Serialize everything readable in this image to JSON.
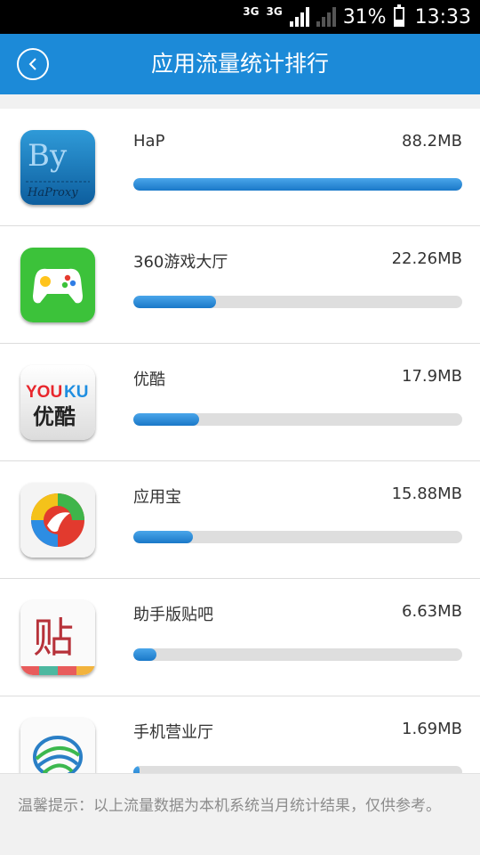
{
  "status_bar": {
    "network_1": "3G",
    "network_2": "3G",
    "battery_percent": "31%",
    "battery_level": 0.31,
    "time": "13:33"
  },
  "header": {
    "title": "应用流量统计排行",
    "back_icon": "back-arrow-icon"
  },
  "apps": [
    {
      "name": "HaP",
      "size": "88.2MB",
      "usage_fraction": 1.0,
      "icon": "haproxy-app-icon",
      "icon_text": "By HaProxy"
    },
    {
      "name": "360游戏大厅",
      "size": "22.26MB",
      "usage_fraction": 0.25,
      "icon": "360-game-hall-app-icon"
    },
    {
      "name": "优酷",
      "size": "17.9MB",
      "usage_fraction": 0.2,
      "icon": "youku-app-icon",
      "icon_text": "YOUKU 优酷"
    },
    {
      "name": "应用宝",
      "size": "15.88MB",
      "usage_fraction": 0.18,
      "icon": "yingyongbao-app-icon"
    },
    {
      "name": "助手版贴吧",
      "size": "6.63MB",
      "usage_fraction": 0.07,
      "icon": "tieba-app-icon",
      "icon_text": "贴"
    },
    {
      "name": "手机营业厅",
      "size": "1.69MB",
      "usage_fraction": 0.019,
      "icon": "china-mobile-app-icon"
    }
  ],
  "colors": {
    "accent": "#1c8ad8",
    "bar_track": "#dedede"
  },
  "footer": {
    "tip": "温馨提示：以上流量数据为本机系统当月统计结果，仅供参考。"
  }
}
